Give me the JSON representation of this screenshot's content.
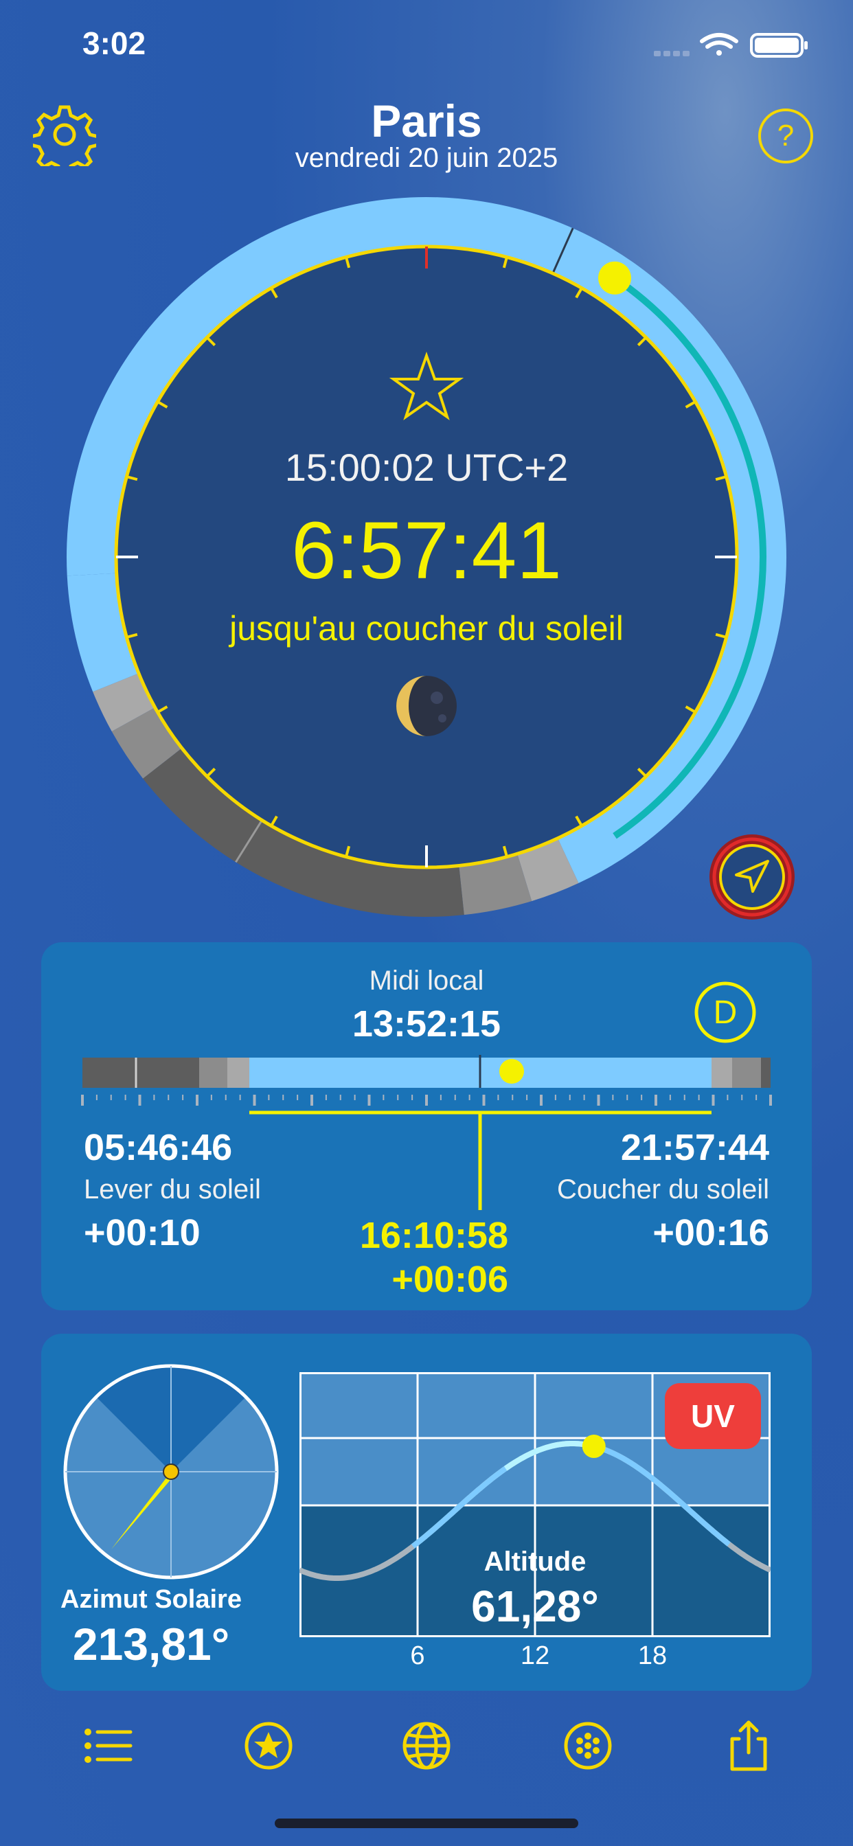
{
  "status_bar": {
    "time": "3:02"
  },
  "header": {
    "city": "Paris",
    "date": "vendredi 20 juin 2025"
  },
  "dial": {
    "clock": "15:00:02 UTC+2",
    "countdown": "6:57:41",
    "caption": "jusqu'au coucher du soleil"
  },
  "day_card": {
    "noon_label": "Midi local",
    "noon_time": "13:52:15",
    "badge": "D",
    "sunrise_time": "05:46:46",
    "sunrise_label": "Lever du soleil",
    "sunrise_delta": "+00:10",
    "sunset_time": "21:57:44",
    "sunset_label": "Coucher du soleil",
    "sunset_delta": "+00:16",
    "remaining_time": "16:10:58",
    "remaining_delta": "+00:06"
  },
  "sun_card": {
    "azimuth_label": "Azimut Solaire",
    "azimuth_value": "213,81°",
    "altitude_label": "Altitude",
    "altitude_value": "61,28°",
    "uv_label": "UV",
    "x_ticks": [
      "6",
      "12",
      "18"
    ]
  },
  "tabbar": {
    "items": [
      "list-icon",
      "star-circle-icon",
      "globe-icon",
      "dots-circle-icon",
      "share-icon"
    ]
  },
  "colors": {
    "accent": "#f5f100",
    "daylight": "#7ecbff",
    "teal": "#10b6b6",
    "card": "#1a73b7",
    "uv": "#ee3e3b"
  }
}
